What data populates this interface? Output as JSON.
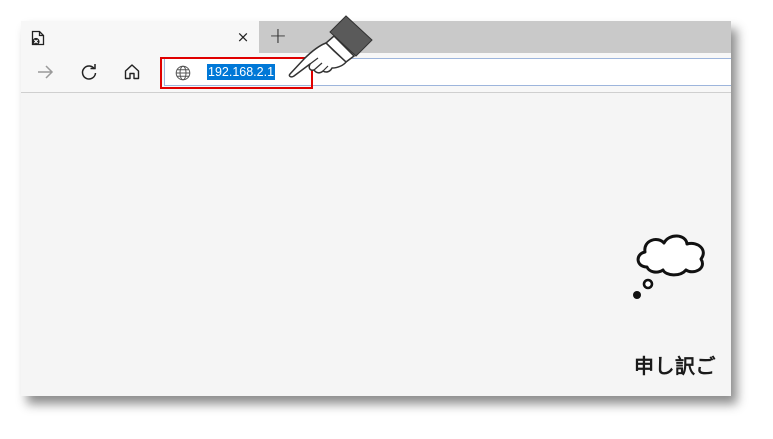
{
  "tabs": [
    {
      "title": "",
      "favicon": "page-error-icon",
      "close_label": "×"
    }
  ],
  "new_tab_label": "+",
  "toolbar": {
    "back_icon": "arrow-right-icon",
    "reload_icon": "reload-icon",
    "home_icon": "home-icon"
  },
  "address_bar": {
    "icon": "globe-icon",
    "url": "192.168.2.1",
    "selected": true,
    "highlight_color": "#e00000"
  },
  "annotation": {
    "icon": "pointing-hand-icon"
  },
  "page": {
    "illustration": "thought-bubble-icon",
    "heading": "申し訳ご"
  },
  "colors": {
    "selection": "#0078d7",
    "page_background": "#f5f5f5",
    "tabstrip": "#c9c9c9"
  }
}
